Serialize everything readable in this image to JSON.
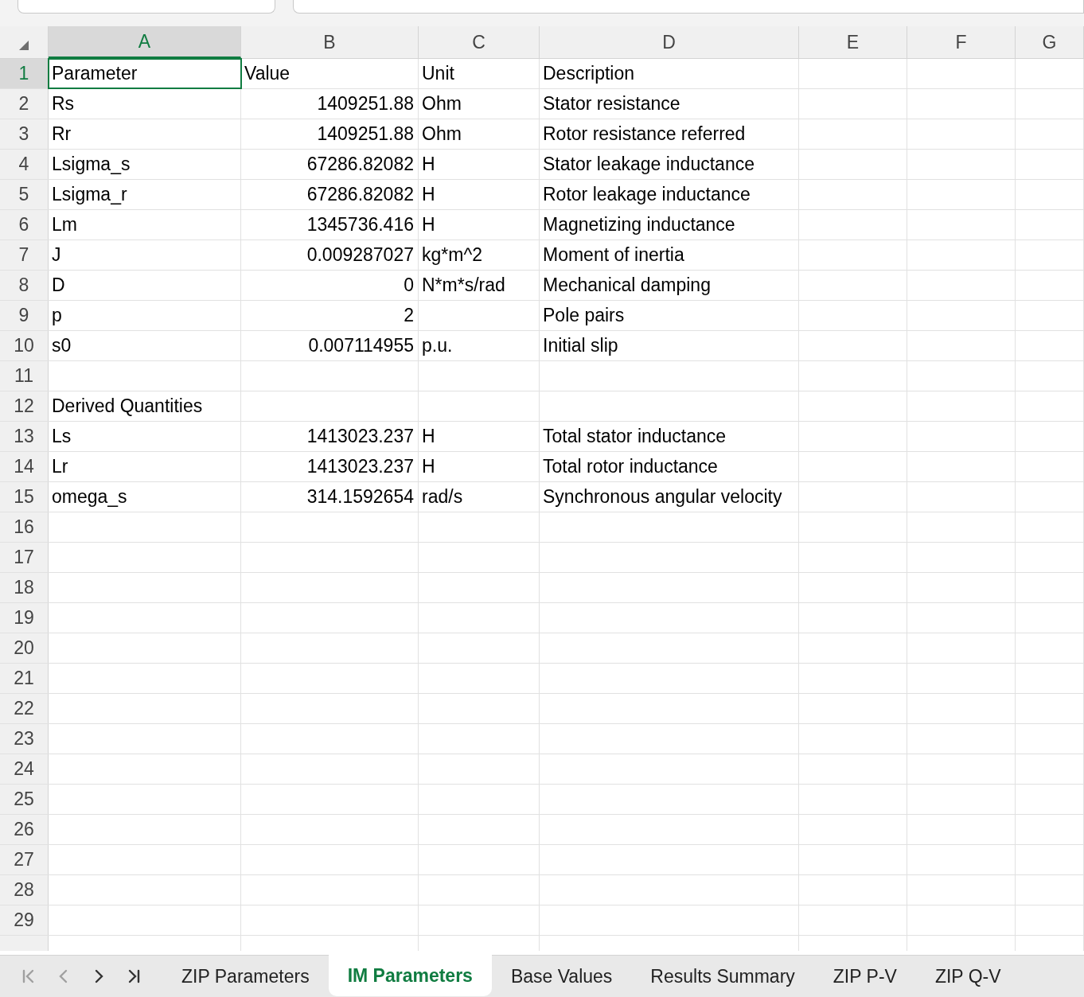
{
  "columns": [
    {
      "label": "A",
      "selected": true
    },
    {
      "label": "B",
      "selected": false
    },
    {
      "label": "C",
      "selected": false
    },
    {
      "label": "D",
      "selected": false
    },
    {
      "label": "E",
      "selected": false
    },
    {
      "label": "F",
      "selected": false
    },
    {
      "label": "G",
      "selected": false
    }
  ],
  "rows": [
    {
      "number": "1",
      "selected": true,
      "cells": {
        "a": {
          "kind": "text",
          "text": "Parameter"
        },
        "b": {
          "kind": "text",
          "text": "Value"
        },
        "c": {
          "kind": "text",
          "text": "Unit"
        },
        "d": {
          "kind": "text",
          "text": "Description"
        }
      }
    },
    {
      "number": "2",
      "selected": false,
      "cells": {
        "a": {
          "kind": "text",
          "text": "Rs"
        },
        "b": {
          "kind": "number",
          "text": "1409251.88"
        },
        "c": {
          "kind": "text",
          "text": "Ohm"
        },
        "d": {
          "kind": "text",
          "text": "Stator resistance"
        }
      }
    },
    {
      "number": "3",
      "selected": false,
      "cells": {
        "a": {
          "kind": "text",
          "text": "Rr"
        },
        "b": {
          "kind": "number",
          "text": "1409251.88"
        },
        "c": {
          "kind": "text",
          "text": "Ohm"
        },
        "d": {
          "kind": "text",
          "text": "Rotor resistance referred"
        }
      }
    },
    {
      "number": "4",
      "selected": false,
      "cells": {
        "a": {
          "kind": "text",
          "text": "Lsigma_s"
        },
        "b": {
          "kind": "number",
          "text": "67286.82082"
        },
        "c": {
          "kind": "text",
          "text": "H"
        },
        "d": {
          "kind": "text",
          "text": "Stator leakage inductance"
        }
      }
    },
    {
      "number": "5",
      "selected": false,
      "cells": {
        "a": {
          "kind": "text",
          "text": "Lsigma_r"
        },
        "b": {
          "kind": "number",
          "text": "67286.82082"
        },
        "c": {
          "kind": "text",
          "text": "H"
        },
        "d": {
          "kind": "text",
          "text": "Rotor leakage inductance"
        }
      }
    },
    {
      "number": "6",
      "selected": false,
      "cells": {
        "a": {
          "kind": "text",
          "text": "Lm"
        },
        "b": {
          "kind": "number",
          "text": "1345736.416"
        },
        "c": {
          "kind": "text",
          "text": "H"
        },
        "d": {
          "kind": "text",
          "text": "Magnetizing inductance"
        }
      }
    },
    {
      "number": "7",
      "selected": false,
      "cells": {
        "a": {
          "kind": "text",
          "text": "J"
        },
        "b": {
          "kind": "number",
          "text": "0.009287027"
        },
        "c": {
          "kind": "text",
          "text": "kg*m^2"
        },
        "d": {
          "kind": "text",
          "text": "Moment of inertia"
        }
      }
    },
    {
      "number": "8",
      "selected": false,
      "cells": {
        "a": {
          "kind": "text",
          "text": "D"
        },
        "b": {
          "kind": "number",
          "text": "0"
        },
        "c": {
          "kind": "text",
          "text": "N*m*s/rad"
        },
        "d": {
          "kind": "text",
          "text": "Mechanical damping"
        }
      }
    },
    {
      "number": "9",
      "selected": false,
      "cells": {
        "a": {
          "kind": "text",
          "text": "p"
        },
        "b": {
          "kind": "number",
          "text": "2"
        },
        "d": {
          "kind": "text",
          "text": "Pole pairs"
        }
      }
    },
    {
      "number": "10",
      "selected": false,
      "cells": {
        "a": {
          "kind": "text",
          "text": "s0"
        },
        "b": {
          "kind": "number",
          "text": "0.007114955"
        },
        "c": {
          "kind": "text",
          "text": "p.u."
        },
        "d": {
          "kind": "text",
          "text": "Initial slip"
        }
      }
    },
    {
      "number": "11",
      "selected": false
    },
    {
      "number": "12",
      "selected": false,
      "cells": {
        "a": {
          "kind": "text",
          "text": "Derived Quantities"
        }
      }
    },
    {
      "number": "13",
      "selected": false,
      "cells": {
        "a": {
          "kind": "text",
          "text": "Ls"
        },
        "b": {
          "kind": "number",
          "text": "1413023.237"
        },
        "c": {
          "kind": "text",
          "text": "H"
        },
        "d": {
          "kind": "text",
          "text": "Total stator inductance"
        }
      }
    },
    {
      "number": "14",
      "selected": false,
      "cells": {
        "a": {
          "kind": "text",
          "text": "Lr"
        },
        "b": {
          "kind": "number",
          "text": "1413023.237"
        },
        "c": {
          "kind": "text",
          "text": "H"
        },
        "d": {
          "kind": "text",
          "text": "Total rotor inductance"
        }
      }
    },
    {
      "number": "15",
      "selected": false,
      "cells": {
        "a": {
          "kind": "text",
          "text": "omega_s"
        },
        "b": {
          "kind": "number",
          "text": "314.1592654"
        },
        "c": {
          "kind": "text",
          "text": "rad/s"
        },
        "d": {
          "kind": "text",
          "text": "Synchronous angular velocity"
        }
      }
    },
    {
      "number": "16",
      "selected": false
    },
    {
      "number": "17",
      "selected": false
    },
    {
      "number": "18",
      "selected": false
    },
    {
      "number": "19",
      "selected": false
    },
    {
      "number": "20",
      "selected": false
    },
    {
      "number": "21",
      "selected": false
    },
    {
      "number": "22",
      "selected": false
    },
    {
      "number": "23",
      "selected": false
    },
    {
      "number": "24",
      "selected": false
    },
    {
      "number": "25",
      "selected": false
    },
    {
      "number": "26",
      "selected": false
    },
    {
      "number": "27",
      "selected": false
    },
    {
      "number": "28",
      "selected": false
    },
    {
      "number": "29",
      "selected": false
    }
  ],
  "sheet_tabs": [
    {
      "label": "ZIP Parameters",
      "selected": false
    },
    {
      "label": "IM Parameters",
      "selected": true
    },
    {
      "label": "Base Values",
      "selected": false
    },
    {
      "label": "Results Summary",
      "selected": false
    },
    {
      "label": "ZIP P-V",
      "selected": false
    },
    {
      "label": "ZIP Q-V",
      "selected": false
    }
  ]
}
